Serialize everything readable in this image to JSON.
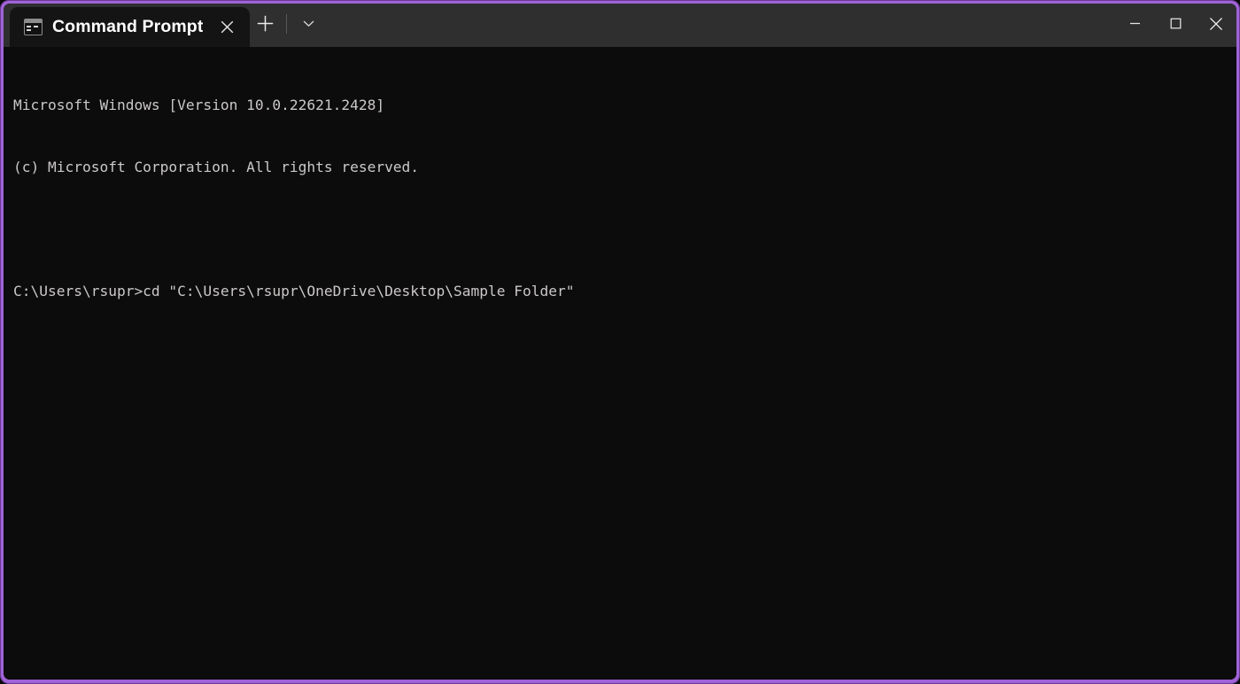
{
  "window": {
    "accent_border_color": "#a163d8",
    "titlebar_color": "#2f2f2f",
    "active_tab_color": "#141414",
    "terminal_bg_color": "#0c0c0c",
    "terminal_fg_color": "#ccc8c8"
  },
  "titlebar": {
    "tabs": [
      {
        "title": "Command Prompt",
        "icon": "console-icon",
        "close_label": "Close tab",
        "active": true
      }
    ],
    "new_tab_label": "New tab",
    "dropdown_label": "Open new tab dropdown",
    "controls": {
      "minimize_label": "Minimize",
      "maximize_label": "Maximize",
      "close_label": "Close"
    }
  },
  "terminal": {
    "lines": [
      "Microsoft Windows [Version 10.0.22621.2428]",
      "(c) Microsoft Corporation. All rights reserved.",
      "",
      "C:\\Users\\rsupr>cd \"C:\\Users\\rsupr\\OneDrive\\Desktop\\Sample Folder\""
    ]
  }
}
